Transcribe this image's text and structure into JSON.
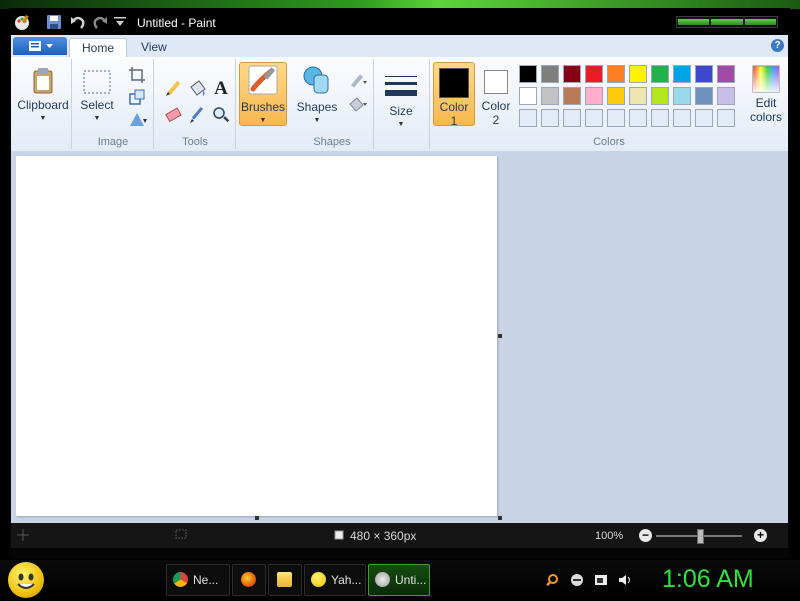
{
  "window": {
    "title": "Untitled - Paint"
  },
  "ribbon_tabs": [
    {
      "label": "Home"
    },
    {
      "label": "View"
    }
  ],
  "help_icon": "?",
  "groups": {
    "clipboard": {
      "button": "Clipboard",
      "label": ""
    },
    "image": {
      "select": "Select",
      "label": "Image"
    },
    "tools": {
      "label": "Tools",
      "text_tool": "A"
    },
    "brushes": {
      "button": "Brushes"
    },
    "shapes": {
      "button": "Shapes",
      "label": "Shapes"
    },
    "size": {
      "button": "Size"
    },
    "colors": {
      "color1": "Color\n1",
      "color1_line1": "Color",
      "color1_line2": "1",
      "color2_line1": "Color",
      "color2_line2": "2",
      "edit_line1": "Edit",
      "edit_line2": "colors",
      "label": "Colors",
      "row1": [
        "#000000",
        "#7f7f7f",
        "#880015",
        "#ed1c24",
        "#ff7f27",
        "#fff200",
        "#22b14c",
        "#00a2e8",
        "#3f48cc",
        "#a349a4"
      ],
      "row2": [
        "#ffffff",
        "#c3c3c3",
        "#b97a57",
        "#ffaec9",
        "#ffc90e",
        "#efe4b0",
        "#b5e61d",
        "#99d9ea",
        "#7092be",
        "#c8bfe7"
      ],
      "color1_value": "#000000",
      "color2_value": "#ffffff"
    }
  },
  "status": {
    "canvas_size": "480 × 360px",
    "zoom": "100%"
  },
  "taskbar": {
    "items": [
      {
        "label": "Ne...",
        "icon": "chrome-icon"
      },
      {
        "label": "",
        "icon": "firefox-icon"
      },
      {
        "label": "",
        "icon": "folder-icon"
      },
      {
        "label": "Yah...",
        "icon": "yahoo-messenger-icon"
      },
      {
        "label": "Unti...",
        "icon": "paint-icon"
      }
    ],
    "clock": "1:06 AM"
  }
}
